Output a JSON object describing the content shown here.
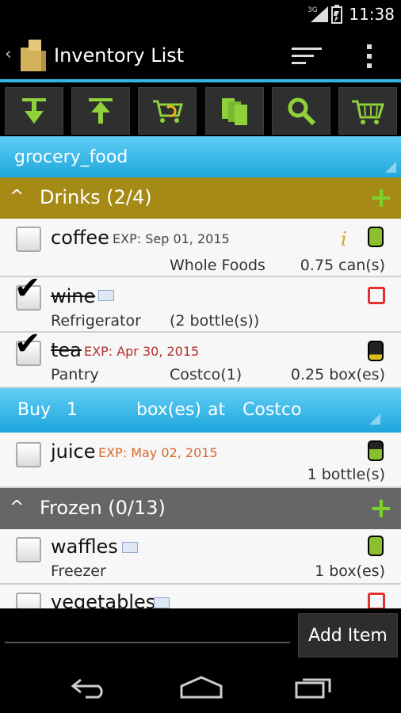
{
  "status": {
    "time": "11:38",
    "network": "3G"
  },
  "actionbar": {
    "title": "Inventory List"
  },
  "toolbar": {
    "buttons": [
      "download-arrow-icon",
      "upload-arrow-icon",
      "cart-sync-icon",
      "copy-icon",
      "search-icon",
      "cart-icon"
    ]
  },
  "category": {
    "label": "grocery_food"
  },
  "groups": [
    {
      "title": "Drinks (2/4)",
      "color": "#a58a15"
    },
    {
      "title": "Frozen (0/13)",
      "color": "#666666"
    }
  ],
  "items": [
    {
      "name": "coffee",
      "exp": "EXP: Sep 01, 2015",
      "store": "Whole Foods",
      "qty": "0.75 can(s)",
      "checked": false
    },
    {
      "name": "wine",
      "location": "Refrigerator",
      "qty": "(2 bottle(s))",
      "checked": true
    },
    {
      "name": "tea",
      "exp": "EXP: Apr 30, 2015",
      "location": "Pantry",
      "store": "Costco(1)",
      "qty": "0.25 box(es)",
      "checked": true
    },
    {
      "name": "juice",
      "exp": "EXP: May 02, 2015",
      "qty": "1 bottle(s)",
      "checked": false
    },
    {
      "name": "waffles",
      "location": "Freezer",
      "qty": "1 box(es)",
      "checked": false
    },
    {
      "name": "vegetables",
      "checked": false
    }
  ],
  "buybar": {
    "buy": "Buy",
    "amount": "1",
    "unit": "box(es)",
    "at": "at",
    "store": "Costco"
  },
  "bottom": {
    "add_label": "Add Item"
  }
}
